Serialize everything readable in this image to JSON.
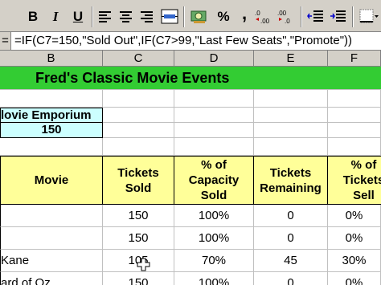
{
  "toolbar": {
    "bold_label": "B",
    "italic_label": "I",
    "underline_label": "U",
    "percent_label": "%",
    "comma_label": ","
  },
  "formula_bar": {
    "eq_label": "=",
    "formula": "=IF(C7=150,\"Sold Out\",IF(C7>99,\"Last Few Seats\",\"Promote\"))"
  },
  "columns": [
    "B",
    "C",
    "D",
    "E",
    "F"
  ],
  "sheet": {
    "title": "Fred's Classic Movie Events",
    "venue_label": "lovie Emporium",
    "capacity": "150",
    "headers": {
      "movie": "Movie",
      "tickets_sold": [
        "Tickets",
        "Sold"
      ],
      "pct_capacity": [
        "% of",
        "Capacity",
        "Sold"
      ],
      "tickets_remaining": [
        "Tickets",
        "Remaining"
      ],
      "pct_tickets": [
        "% of",
        "Tickets",
        "Sell"
      ]
    },
    "rows": [
      {
        "movie": "",
        "sold": "150",
        "pct": "100%",
        "remaining": "0",
        "pct2": "0%"
      },
      {
        "movie": "",
        "sold": "150",
        "pct": "100%",
        "remaining": "0",
        "pct2": "0%"
      },
      {
        "movie": "Kane",
        "sold": "105",
        "pct": "70%",
        "remaining": "45",
        "pct2": "30%"
      },
      {
        "movie": "ard of Oz",
        "sold": "150",
        "pct": "100%",
        "remaining": "0",
        "pct2": "0%"
      }
    ]
  }
}
